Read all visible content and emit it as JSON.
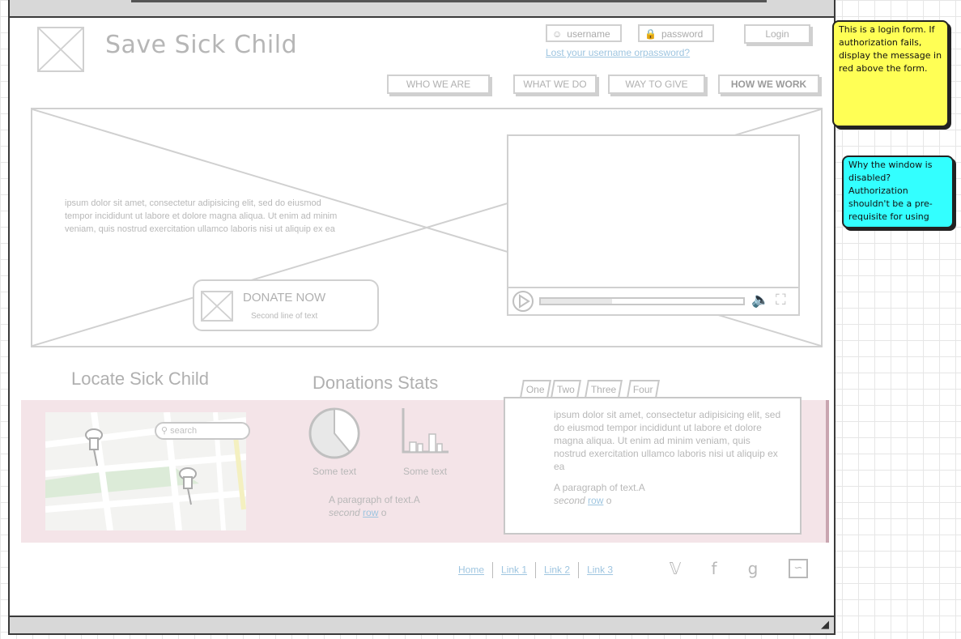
{
  "site": {
    "title": "Save Sick Child"
  },
  "login": {
    "username_placeholder": "username",
    "password_placeholder": "password",
    "button_label": "Login",
    "lost_link": "Lost your username orpassword?"
  },
  "nav": {
    "items": [
      {
        "label": "WHO WE ARE"
      },
      {
        "label": "WHAT WE DO"
      },
      {
        "label": "WAY TO GIVE"
      },
      {
        "label": "HOW WE WORK"
      }
    ]
  },
  "hero": {
    "text": " ipsum dolor sit amet, consectetur adipisicing elit, sed do eiusmod tempor incididunt ut labore et dolore magna aliqua. Ut enim ad minim veniam, quis nostrud exercitation ullamco laboris nisi ut aliquip ex ea",
    "donate_label": "DONATE NOW",
    "donate_sub": "Second line of text",
    "video_progress": 0.35
  },
  "locate": {
    "title": "Locate Sick Child",
    "search_placeholder": "search"
  },
  "stats": {
    "title": "Donations Stats",
    "caption_left": "Some text",
    "caption_right": "Some text",
    "para_line1": "A paragraph of text.A",
    "para_line2_prefix": "second",
    "para_link": "row",
    "para_suffix": "o"
  },
  "tabs": {
    "items": [
      {
        "label": "One"
      },
      {
        "label": "Two"
      },
      {
        "label": "Three"
      },
      {
        "label": "Four"
      }
    ],
    "panel_text": " ipsum dolor sit amet, consectetur adipisicing elit, sed do eiusmod tempor incididunt ut labore et dolore magna aliqua. Ut enim ad minim veniam, quis nostrud exercitation ullamco laboris nisi ut aliquip ex ea",
    "para_line1": "A paragraph of text.A",
    "para_line2_prefix": "second",
    "para_link": "row",
    "para_suffix": "o"
  },
  "footer": {
    "links": [
      "Home",
      "Link 1",
      "Link 2",
      "Link 3"
    ],
    "social_icons": [
      "twitter-icon",
      "facebook-icon",
      "google-icon",
      "rss-icon"
    ]
  },
  "notes": {
    "yellow": "This is a login form.  If authorization fails, display the message in red above the form.",
    "cyan": "Why the window is disabled? Authorization shouldn't be a pre-requisite for using"
  },
  "colors": {
    "note_yellow": "#ffff55",
    "note_cyan": "#33ffff",
    "section_band": "#f4e4e8",
    "link": "#9ec5e0"
  }
}
